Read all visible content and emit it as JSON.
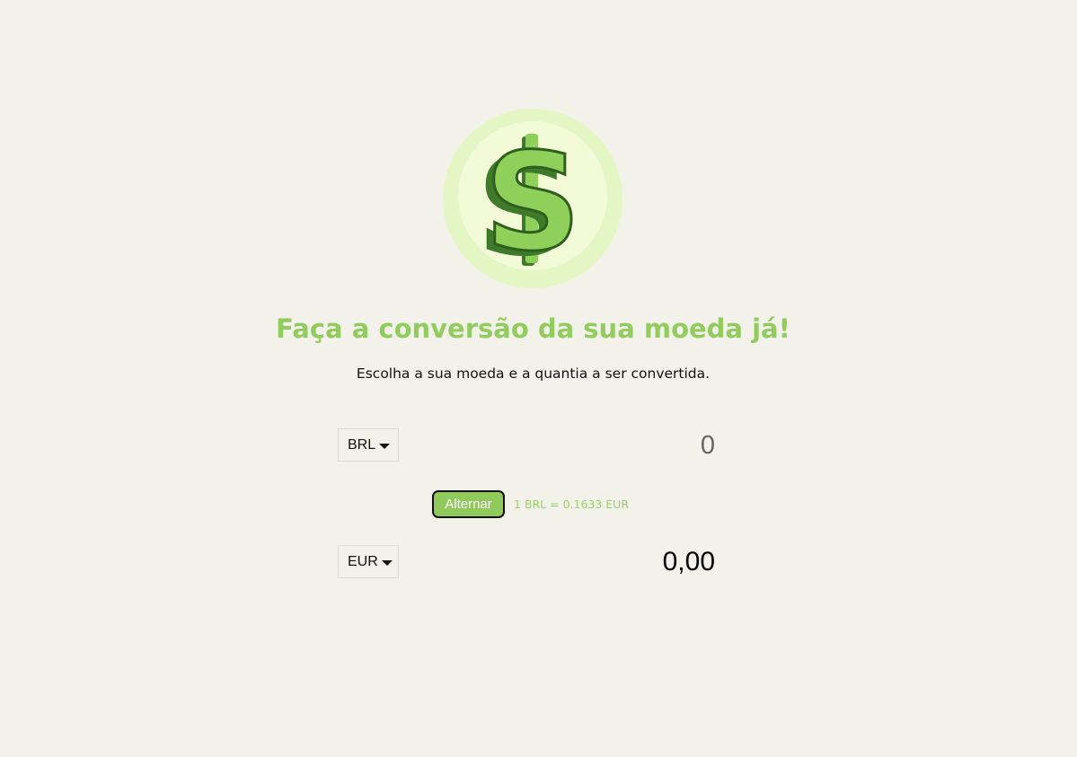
{
  "header": {
    "logo_icon": "dollar-coin-icon",
    "title": "Faça a conversão da sua moeda já!",
    "subtitle": "Escolha a sua moeda e a quantia a ser convertida."
  },
  "converter": {
    "from": {
      "currency": "BRL",
      "amount_placeholder": "0"
    },
    "swap_label": "Alternar",
    "rate_text": "1 BRL = 0.1633 EUR",
    "to": {
      "currency": "EUR",
      "result": "0,00"
    }
  },
  "colors": {
    "background": "#f3f2ea",
    "accent": "#92cc5e",
    "coin_outer": "#e4f6c4",
    "coin_inner": "#f3fad8"
  }
}
